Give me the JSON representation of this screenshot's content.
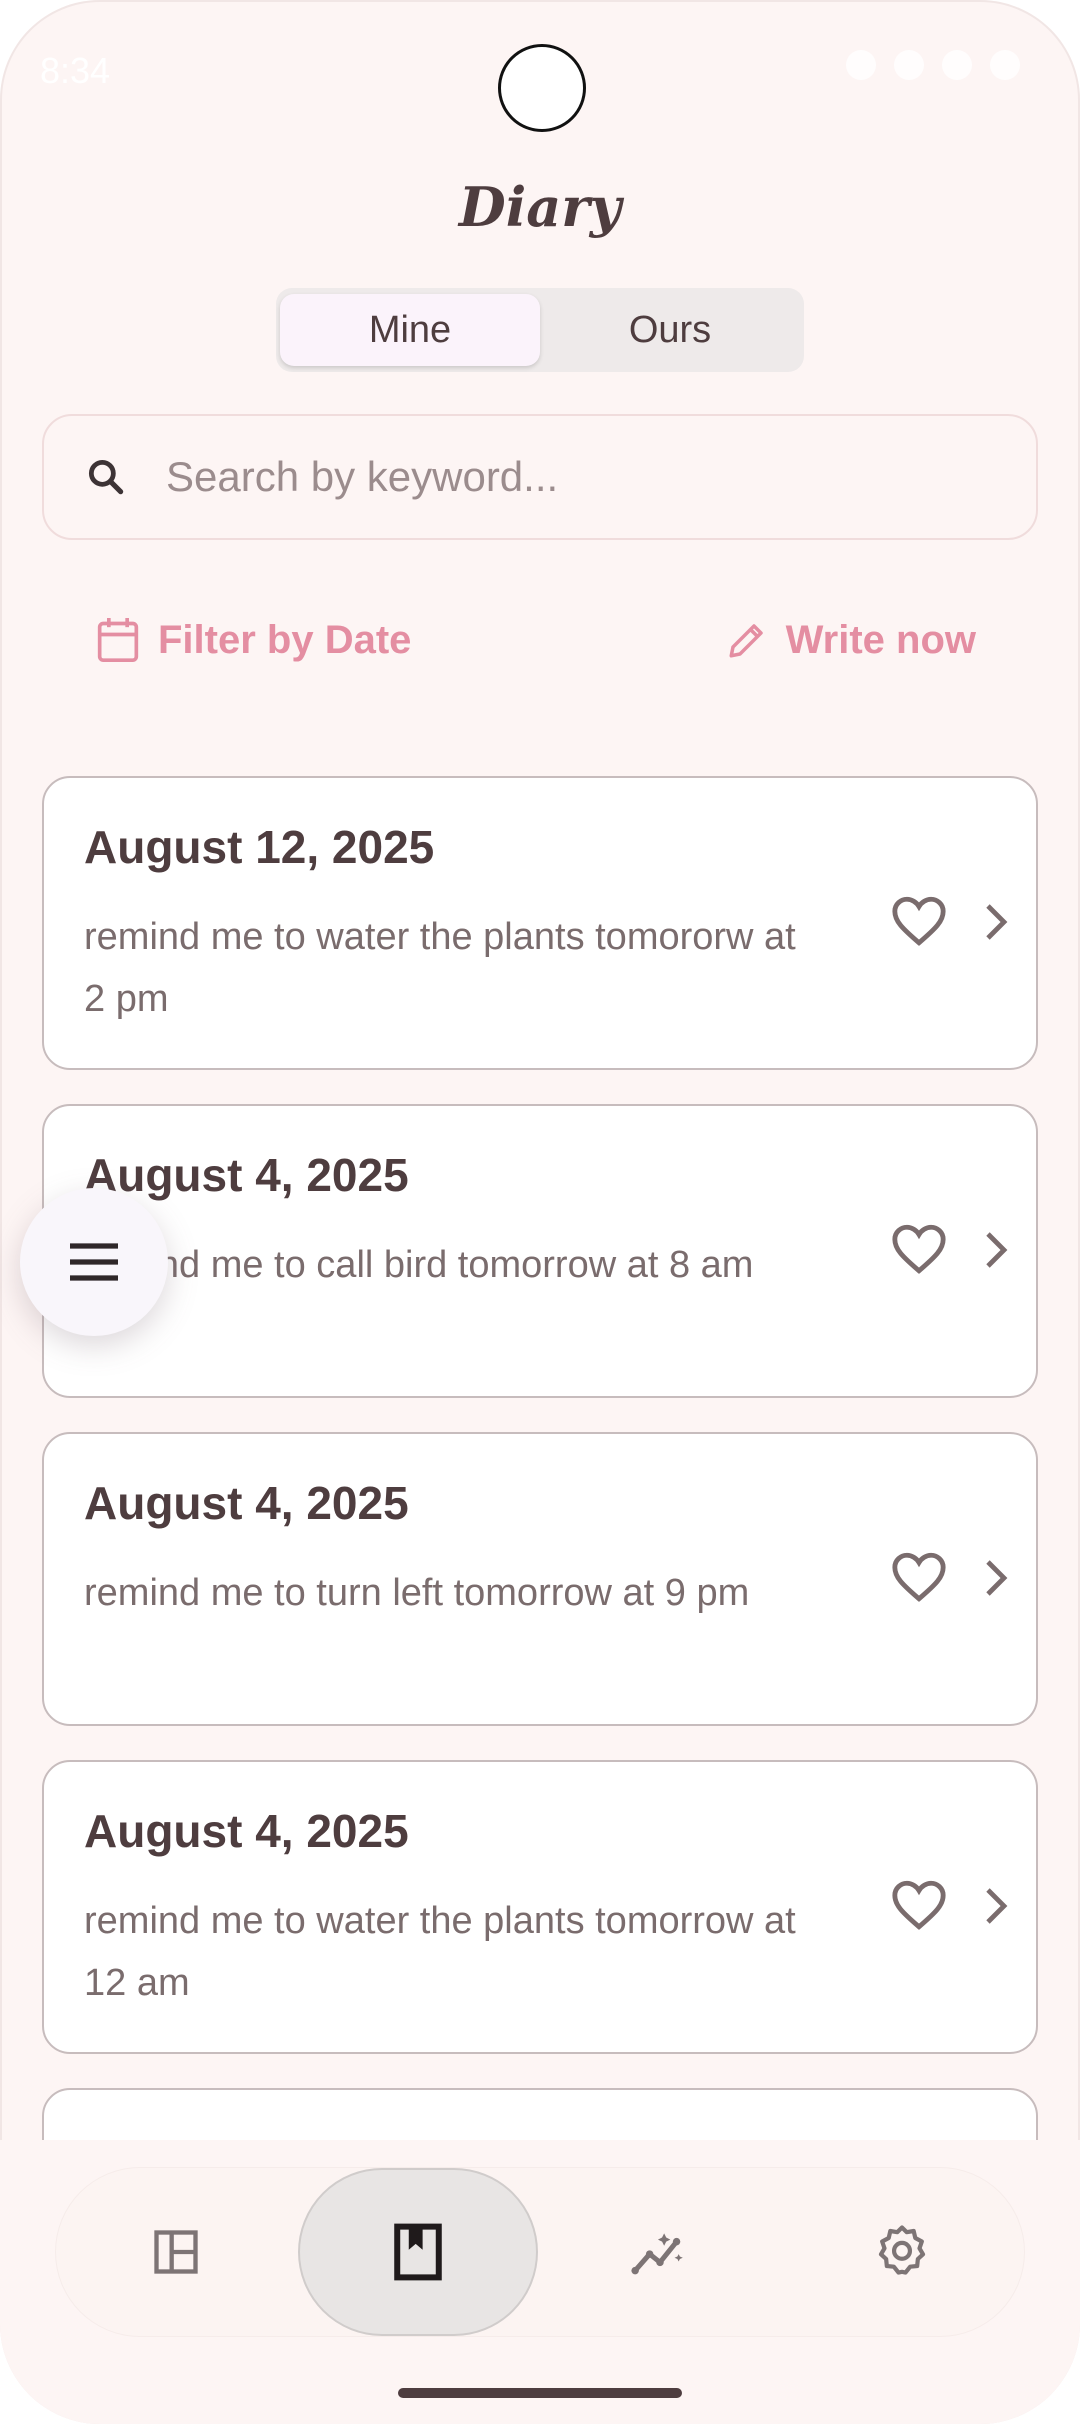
{
  "status_bar": {
    "time": "8:34"
  },
  "header": {
    "title": "Diary"
  },
  "segmented": {
    "options": [
      "Mine",
      "Ours"
    ],
    "selected": "Mine"
  },
  "search": {
    "placeholder": "Search by keyword..."
  },
  "actions": {
    "filter_label": "Filter by Date",
    "write_label": "Write now"
  },
  "entries": [
    {
      "date": "August 12, 2025",
      "text": "remind me to water the plants tomororw at 2 pm"
    },
    {
      "date": "August 4, 2025",
      "text": "remind me to call bird tomorrow at 8 am"
    },
    {
      "date": "August 4, 2025",
      "text": "remind me to turn left tomorrow at 9 pm"
    },
    {
      "date": "August 4, 2025",
      "text": "remind me to water the plants tomorrow at 12 am"
    }
  ],
  "bottom_nav": {
    "items": [
      "dashboard-icon",
      "diary-bookmark-icon",
      "insights-icon",
      "settings-icon"
    ],
    "active": "diary-bookmark-icon"
  },
  "colors": {
    "accent": "#e48ea2",
    "text": "#4e3d3f",
    "background": "#fdf5f4"
  }
}
